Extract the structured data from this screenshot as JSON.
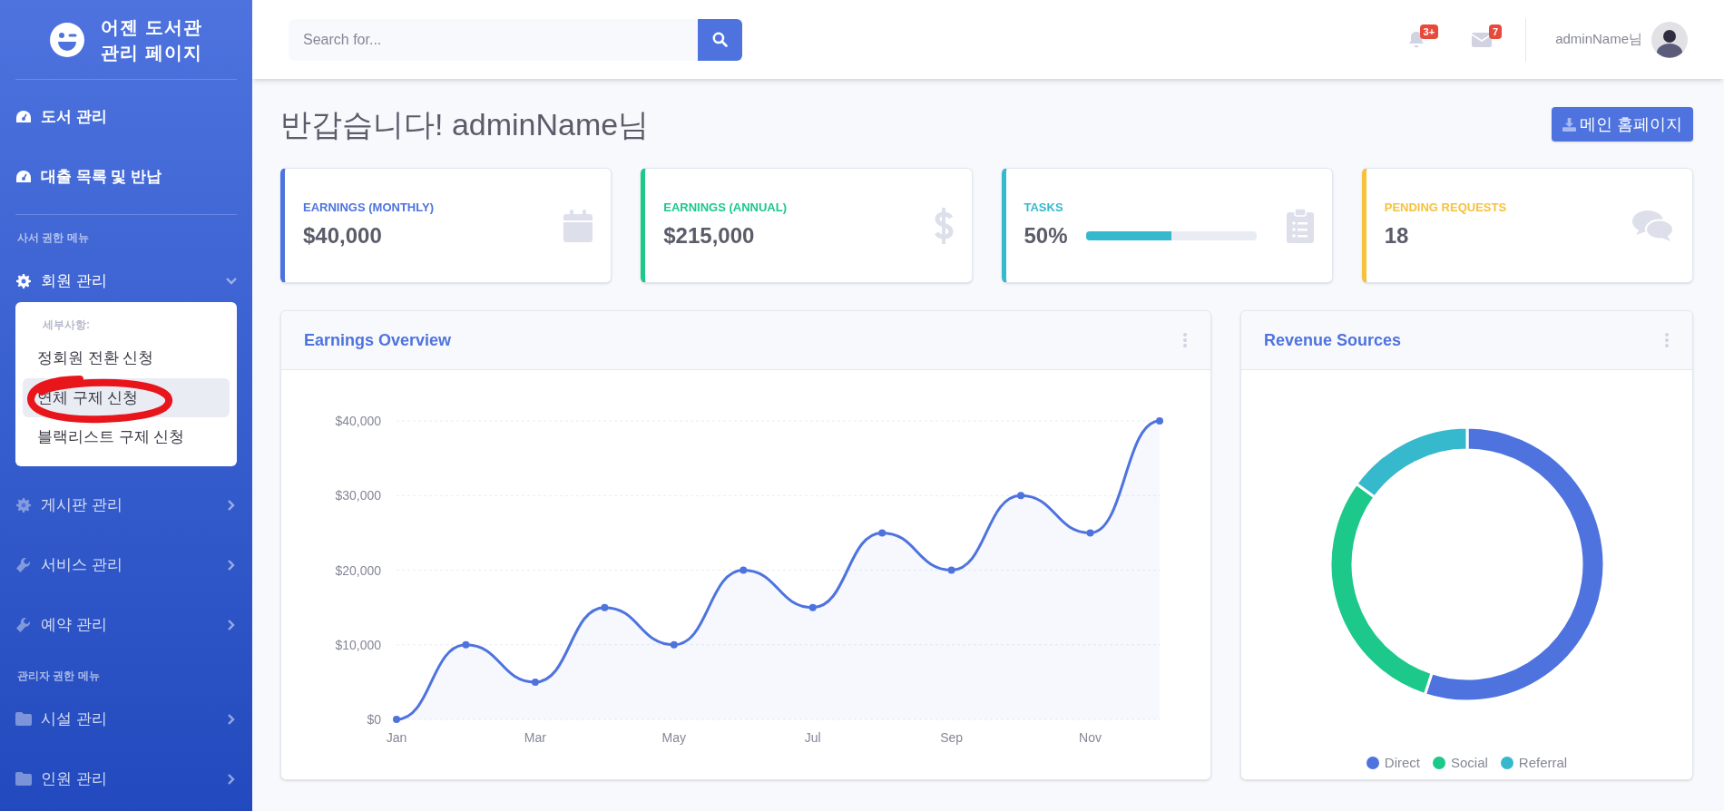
{
  "sidebar": {
    "brand": "어젠 도서관\n관리 페이지",
    "sections": [
      {
        "items": [
          {
            "label": "도서 관리",
            "kind": "link"
          },
          {
            "label": "대출 목록 및 반납",
            "kind": "link"
          }
        ]
      },
      {
        "heading": "사서 권한 메뉴",
        "items": [
          {
            "label": "회원 관리",
            "kind": "collapse",
            "expanded": true,
            "submenu": {
              "heading": "세부사항:",
              "items": [
                {
                  "label": "정회원 전환 신청",
                  "selected": false
                },
                {
                  "label": "연체 구제 신청",
                  "selected": true
                },
                {
                  "label": "블랙리스트 구제 신청",
                  "selected": false
                }
              ]
            }
          },
          {
            "label": "게시판 관리",
            "kind": "collapse",
            "expanded": false
          },
          {
            "label": "서비스 관리",
            "kind": "collapse",
            "expanded": false
          },
          {
            "label": "예약 관리",
            "kind": "collapse",
            "expanded": false
          }
        ]
      },
      {
        "heading": "관리자 권한 메뉴",
        "items": [
          {
            "label": "시설 관리",
            "kind": "collapse",
            "expanded": false
          },
          {
            "label": "인원 관리",
            "kind": "collapse",
            "expanded": false
          }
        ]
      }
    ]
  },
  "topbar": {
    "search": {
      "placeholder": "Search for..."
    },
    "alerts_badge": "3+",
    "messages_badge": "7",
    "user": "adminName님"
  },
  "page": {
    "title": "반갑습니다! adminName님",
    "button": "메인 홈페이지"
  },
  "stats": [
    {
      "label": "EARNINGS (MONTHLY)",
      "value": "$40,000",
      "color": "#4e73df"
    },
    {
      "label": "EARNINGS (ANNUAL)",
      "value": "$215,000",
      "color": "#1cc88a"
    },
    {
      "label": "TASKS",
      "value": "50%",
      "color": "#36b9cc",
      "level": 0.5
    },
    {
      "label": "PENDING REQUESTS",
      "value": "18",
      "color": "#f6c23e"
    }
  ],
  "earnings": {
    "title": "Earnings Overview",
    "chart_data": {
      "type": "area",
      "categories": [
        "Jan",
        null,
        "Mar",
        null,
        "May",
        null,
        "Jul",
        null,
        "Sep",
        null,
        "Nov",
        null
      ],
      "series": [
        {
          "color": "#4e73df",
          "values": [
            0,
            10000,
            5000,
            15000,
            10000,
            20000,
            15000,
            25000,
            20000,
            30000,
            25000,
            40000
          ]
        }
      ],
      "ylim": [
        0,
        40000
      ],
      "grid": true,
      "yticks": [
        {
          "value": 0,
          "label": "$0"
        },
        {
          "value": 10000,
          "label": "$10,000"
        },
        {
          "value": 20000,
          "label": "$20,000"
        },
        {
          "value": 30000,
          "label": "$30,000"
        },
        {
          "value": 40000,
          "label": "$40,000"
        }
      ]
    }
  },
  "revenue": {
    "title": "Revenue Sources",
    "chart_data": {
      "type": "donut",
      "legend": "bottom",
      "categories": [
        "Direct",
        "Social",
        "Referral"
      ],
      "values": [
        55,
        30,
        15
      ],
      "colors": [
        "#4e73df",
        "#1cc88a",
        "#36b9cc"
      ]
    }
  }
}
